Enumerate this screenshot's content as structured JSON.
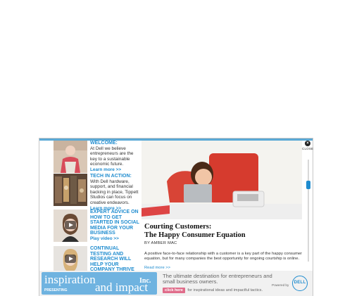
{
  "sidebar": {
    "items": [
      {
        "heading": "WELCOME:",
        "body": "At Dell we believe entrepreneurs are the key to a sustainable economic future.",
        "link": "Learn more >>"
      },
      {
        "heading": "TECH IN ACTION:",
        "body": "With Dell hardware, support, and financial backing in place, Tippett Studios can focus on creative endeavors.",
        "link": "Learn more >>"
      },
      {
        "heading": "EXPERT ADVICE ON HOW TO GET STARTED IN SOCIAL MEDIA FOR YOUR BUSINESS",
        "body": "",
        "link": "Play video >>"
      },
      {
        "heading": "CONTINUAL TESTING AND RESEARCH WILL HELP YOUR COMPANY THRIVE",
        "body": "",
        "link": ""
      }
    ]
  },
  "article": {
    "title_line1": "Courting Customers:",
    "title_line2": "The Happy Consumer Equation",
    "byline": "BY AMBER MAC",
    "body": "A positive face-to-face relationship with a customer is a key part of the happy consumer equation, but for many companies the best opportunity for ongoing courtship is online.",
    "more": "Read more >>"
  },
  "controls": {
    "close_label": "CLOSE",
    "close_glyph": "×"
  },
  "banner": {
    "brand_word1": "inspiration",
    "brand_small": "PRESENTING",
    "brand_word2": "and impact",
    "brand_mag": "Inc.",
    "tagline": "The ultimate destination for entrepreneurs and small business owners.",
    "cta_button": "click here",
    "cta_text": "for inspirational ideas and impactful tactics.",
    "powered_by": "Powered by",
    "dell_logo": "DELL"
  },
  "colors": {
    "accent": "#1f8ccf",
    "brand_bg": "#6fb3e0",
    "cta": "#e06c8a"
  }
}
